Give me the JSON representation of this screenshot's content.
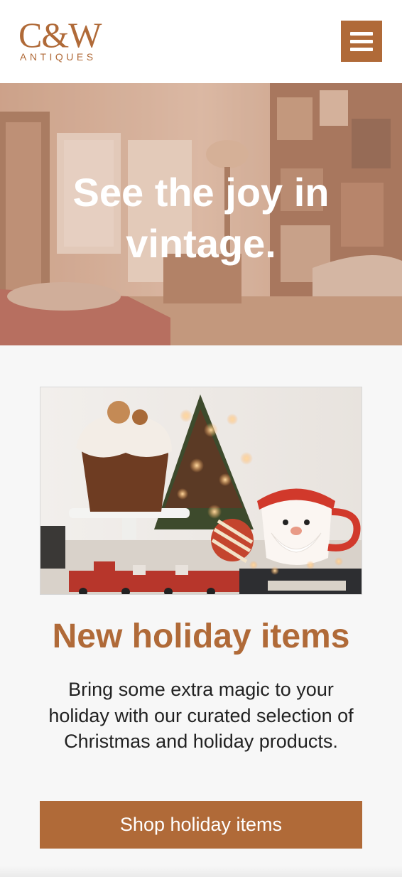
{
  "header": {
    "logo_mark": "C&W",
    "logo_sub": "ANTIQUES",
    "brand_color": "#b06a38",
    "menu_icon": "hamburger-menu-icon"
  },
  "hero": {
    "title": "See the joy in vintage.",
    "overlay_color": "#c08a6a"
  },
  "feature": {
    "image_subject": "holiday-cake-christmas-tree-santa-mug",
    "title": "New holiday items",
    "body": "Bring some extra magic to your holiday with our curated selection of Christmas and holiday products.",
    "cta_label": "Shop holiday items"
  }
}
